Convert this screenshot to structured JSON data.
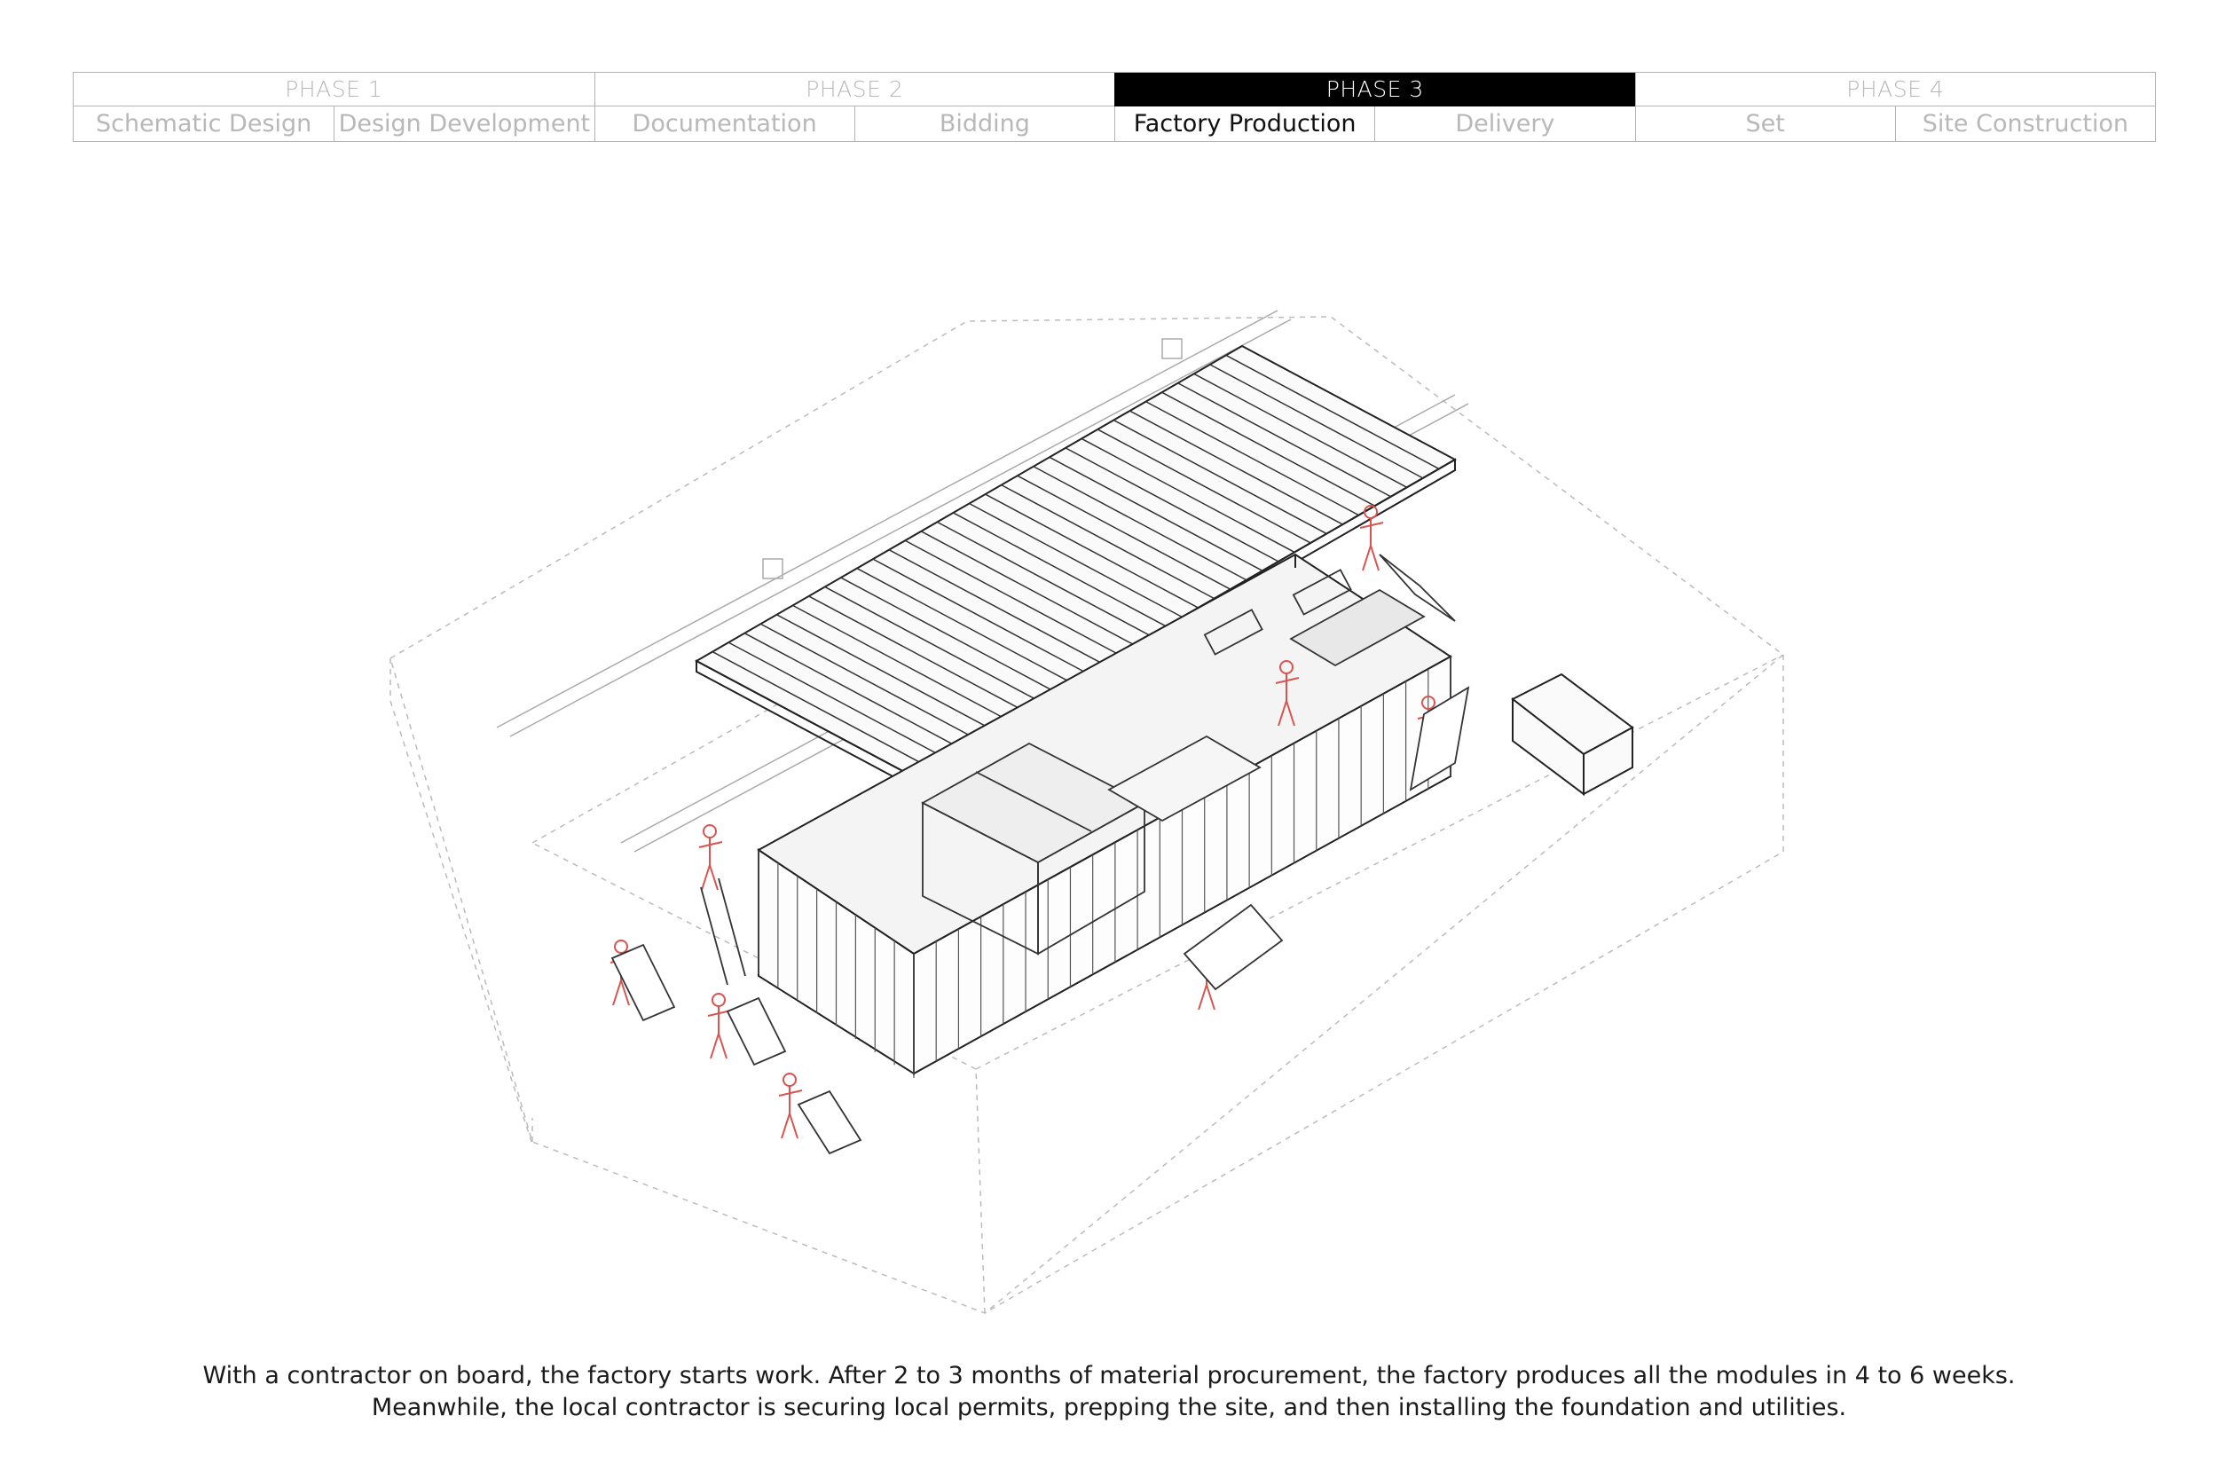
{
  "phases": [
    {
      "label": "PHASE 1",
      "active": false
    },
    {
      "label": "PHASE 2",
      "active": false
    },
    {
      "label": "PHASE 3",
      "active": true
    },
    {
      "label": "PHASE 4",
      "active": false
    }
  ],
  "steps": [
    {
      "label": "Schematic Design",
      "active": false
    },
    {
      "label": "Design Development",
      "active": false
    },
    {
      "label": "Documentation",
      "active": false
    },
    {
      "label": "Bidding",
      "active": false
    },
    {
      "label": "Factory Production",
      "active": true
    },
    {
      "label": "Delivery",
      "active": false
    },
    {
      "label": "Set",
      "active": false
    },
    {
      "label": "Site Construction",
      "active": false
    }
  ],
  "caption": {
    "line1": "With a contractor on board, the factory starts work. After 2 to 3 months of material procurement, the factory produces all the modules in 4 to 6 weeks.",
    "line2": "Meanwhile, the local contractor is securing local permits, prepping the site, and then installing the foundation and utilities."
  },
  "colors": {
    "active_phase_bg": "#000000",
    "inactive_text": "#b8b8b8",
    "figure_accent": "#d9534f",
    "line_art": "#333333"
  }
}
